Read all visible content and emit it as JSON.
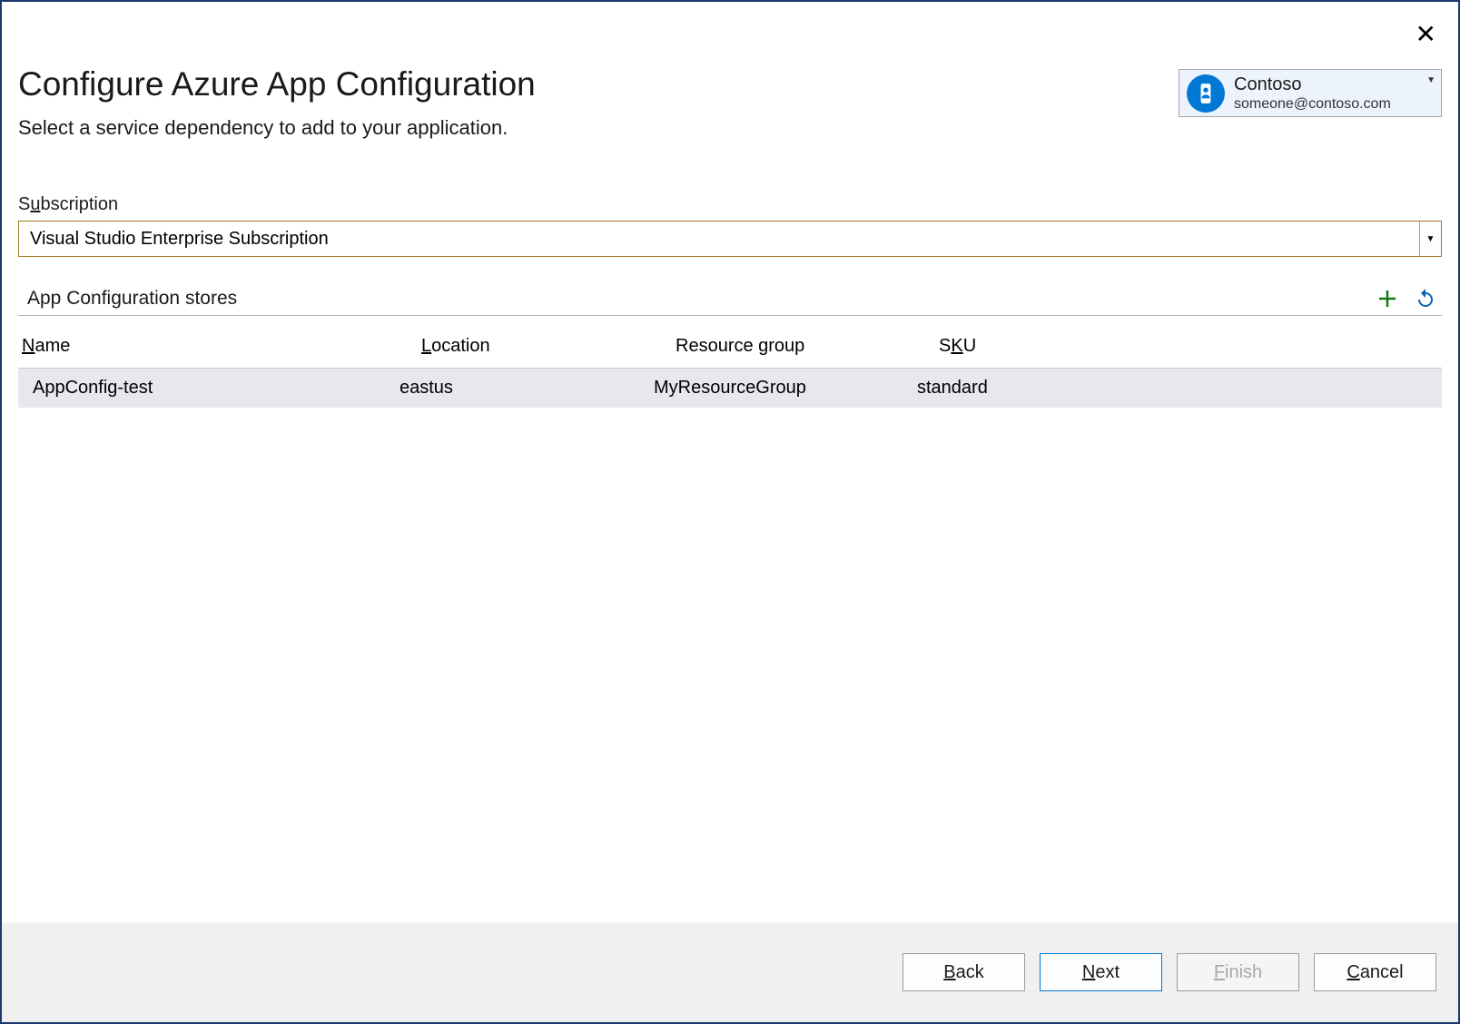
{
  "dialog": {
    "title": "Configure Azure App Configuration",
    "subtitle": "Select a service dependency to add to your application."
  },
  "account": {
    "name": "Contoso",
    "email": "someone@contoso.com"
  },
  "subscription": {
    "label_pre": "S",
    "label_ul": "u",
    "label_post": "bscription",
    "selected": "Visual Studio Enterprise Subscription"
  },
  "stores": {
    "section_label": "App Configuration stores",
    "columns": {
      "name_ul": "N",
      "name_post": "ame",
      "loc_ul": "L",
      "loc_post": "ocation",
      "rg": "Resource group",
      "sku_pre": "S",
      "sku_ul": "K",
      "sku_post": "U"
    },
    "rows": [
      {
        "name": "AppConfig-test",
        "location": "eastus",
        "resource_group": "MyResourceGroup",
        "sku": "standard"
      }
    ]
  },
  "buttons": {
    "back_ul": "B",
    "back_post": "ack",
    "next_ul": "N",
    "next_post": "ext",
    "finish_ul": "F",
    "finish_post": "inish",
    "cancel_ul": "C",
    "cancel_post": "ancel"
  }
}
